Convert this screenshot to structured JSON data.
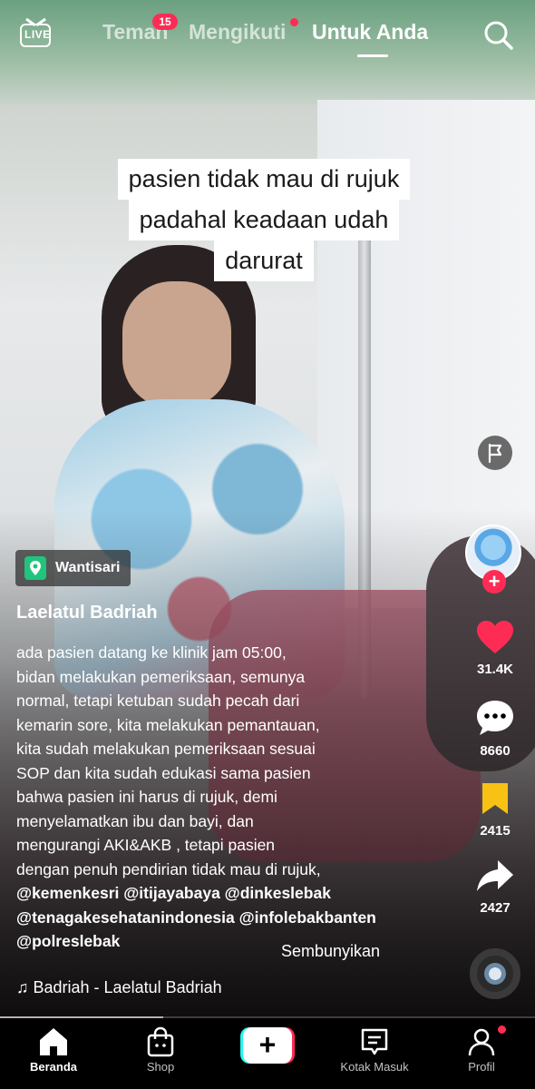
{
  "topbar": {
    "live_label": "LIVE",
    "tabs": [
      {
        "label": "Teman",
        "badge": "15"
      },
      {
        "label": "Mengikuti"
      },
      {
        "label": "Untuk Anda"
      }
    ]
  },
  "video": {
    "caption_lines": [
      "pasien tidak mau di rujuk",
      "padahal keadaan udah",
      "darurat"
    ]
  },
  "post": {
    "location": "Wantisari",
    "author": "Laelatul Badriah",
    "description_lines": [
      "ada pasien datang ke klinik jam 05:00,",
      "bidan melakukan pemeriksaan,  semunya",
      "normal, tetapi ketuban sudah pecah dari",
      "kemarin sore, kita melakukan pemantauan,",
      "kita sudah melakukan pemeriksaan sesuai",
      "SOP  dan kita sudah edukasi sama pasien",
      "bahwa pasien ini harus di rujuk, demi",
      "menyelamatkan ibu dan bayi, dan",
      "mengurangi AKI&AKB , tetapi pasien",
      "dengan penuh pendirian tidak mau di rujuk,"
    ],
    "mention_lines": [
      "@kemenkesri @itijayabaya @dinkeslebak",
      "@tenagakesehatanindonesia @infolebakbanten",
      "@polreslebak"
    ],
    "hide_label": "Sembunyikan",
    "music": "♫ Badriah - Laelatul Badriah"
  },
  "actions": {
    "likes": "31.4K",
    "comments": "8660",
    "saves": "2415",
    "shares": "2427"
  },
  "nav": {
    "items": [
      {
        "label": "Beranda"
      },
      {
        "label": "Shop"
      },
      {
        "label": "+"
      },
      {
        "label": "Kotak Masuk"
      },
      {
        "label": "Profil"
      }
    ]
  },
  "colors": {
    "accent_red": "#fe2c55",
    "accent_cyan": "#25f4ee",
    "save_yellow": "#f8c215",
    "location_green": "#20c47c"
  },
  "icons": [
    "live-icon",
    "search-icon",
    "report-flag-icon",
    "heart-icon",
    "comment-icon",
    "bookmark-icon",
    "share-icon",
    "location-pin-icon",
    "home-icon",
    "shop-bag-icon",
    "plus-icon",
    "inbox-icon",
    "profile-icon"
  ]
}
